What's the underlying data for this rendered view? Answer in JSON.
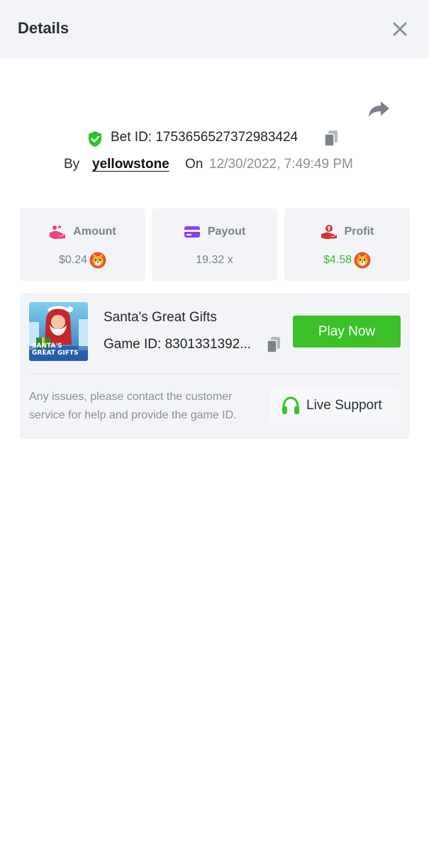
{
  "header": {
    "title": "Details"
  },
  "bet": {
    "id_text": "Bet ID: 1753656527372983424",
    "by_label": "By",
    "username": "yellowstone",
    "on_label": "On",
    "date": "12/30/2022, 7:49:49 PM"
  },
  "stats": [
    {
      "label": "Amount",
      "value": "$0.24",
      "icon": "hand-coins-icon"
    },
    {
      "label": "Payout",
      "value": "19.32 x",
      "icon": "card-icon"
    },
    {
      "label": "Profit",
      "value": "$4.58",
      "icon": "hand-money-icon"
    }
  ],
  "game": {
    "name": "Santa's Great Gifts",
    "id_text": "Game ID: 8301331392...",
    "thumb_text": "SANTA'S GREAT GIFTS",
    "play_label": "Play Now",
    "issue_text": "Any issues, please contact the customer service for help and provide the game ID.",
    "support_label": "Live Support"
  },
  "colors": {
    "accent_green": "#3cc12a",
    "profit_green": "#3cbe2a",
    "amount_pink": "#e8457a",
    "payout_purple": "#8a3ffc",
    "profit_red": "#d6303a"
  }
}
